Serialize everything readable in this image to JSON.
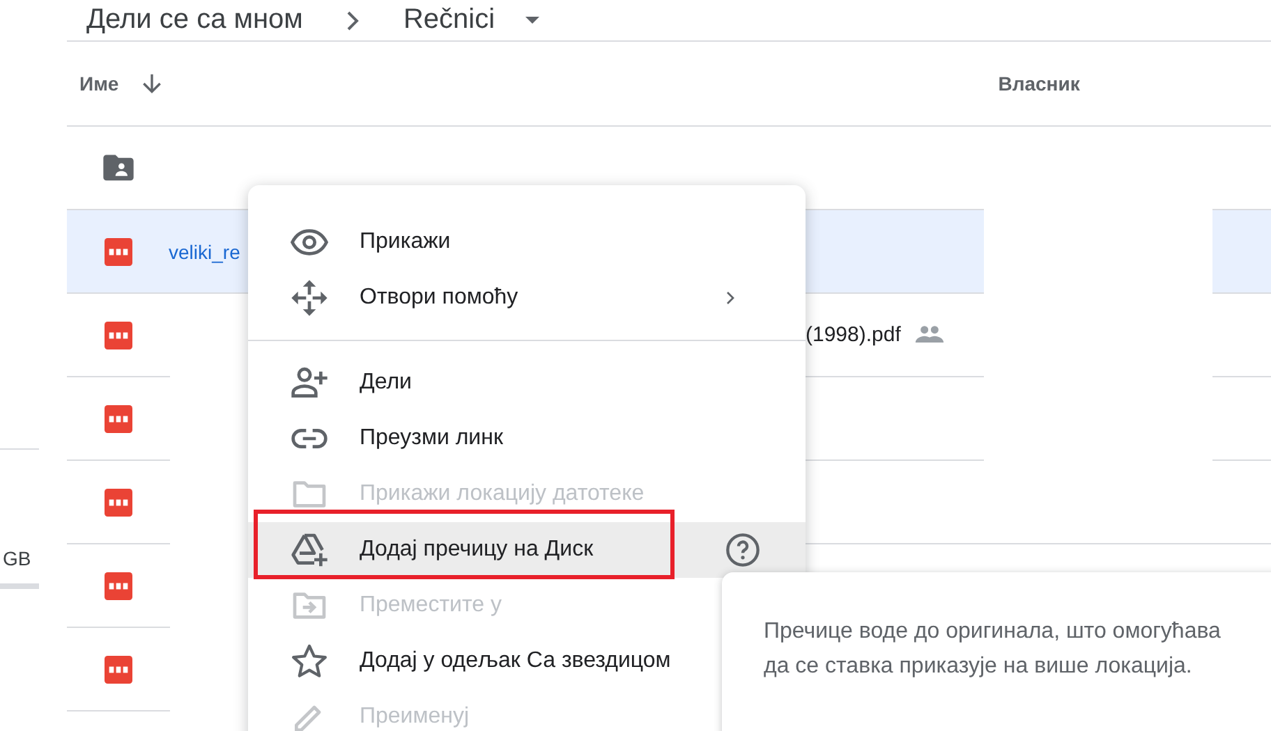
{
  "breadcrumb": {
    "items": [
      "Дели се са мном",
      "Rečnici"
    ]
  },
  "sidebar": {
    "storage_text": "GB"
  },
  "table": {
    "columns": [
      "Име",
      "Власник"
    ],
    "rows": [
      {
        "kind": "folder",
        "selected": false
      },
      {
        "kind": "pdf",
        "selected": true,
        "name_start": "veliki_re"
      },
      {
        "kind": "pdf",
        "selected": false,
        "name_end": "(1998).pdf",
        "shared": true
      },
      {
        "kind": "pdf",
        "selected": false
      },
      {
        "kind": "pdf",
        "selected": false
      },
      {
        "kind": "pdf",
        "selected": false
      },
      {
        "kind": "pdf",
        "selected": false
      }
    ]
  },
  "context_menu": {
    "items": [
      {
        "kind": "item",
        "label": "Прикажи",
        "disabled": false,
        "selected": false
      },
      {
        "kind": "item",
        "label": "Отвори помоћу",
        "disabled": false,
        "selected": false,
        "submenu": true
      },
      {
        "kind": "divider"
      },
      {
        "kind": "item",
        "label": "Дели",
        "disabled": false,
        "selected": false
      },
      {
        "kind": "item",
        "label": "Преузми линк",
        "disabled": false,
        "selected": false
      },
      {
        "kind": "item",
        "label": "Прикажи локацију датотеке",
        "disabled": true,
        "selected": false
      },
      {
        "kind": "item",
        "label": "Додај пречицу на Диск",
        "disabled": false,
        "selected": true,
        "help": true,
        "outlined": true
      },
      {
        "kind": "item",
        "label": "Преместите у",
        "disabled": true,
        "selected": false
      },
      {
        "kind": "item",
        "label": "Додај у одељак Са звездицом",
        "disabled": false,
        "selected": false
      },
      {
        "kind": "item",
        "label": "Преименуј",
        "disabled": true,
        "selected": false
      }
    ]
  },
  "tooltip": {
    "text": "Пречице воде до оригинала, што омогућава да се ставка приказује на више локација."
  }
}
